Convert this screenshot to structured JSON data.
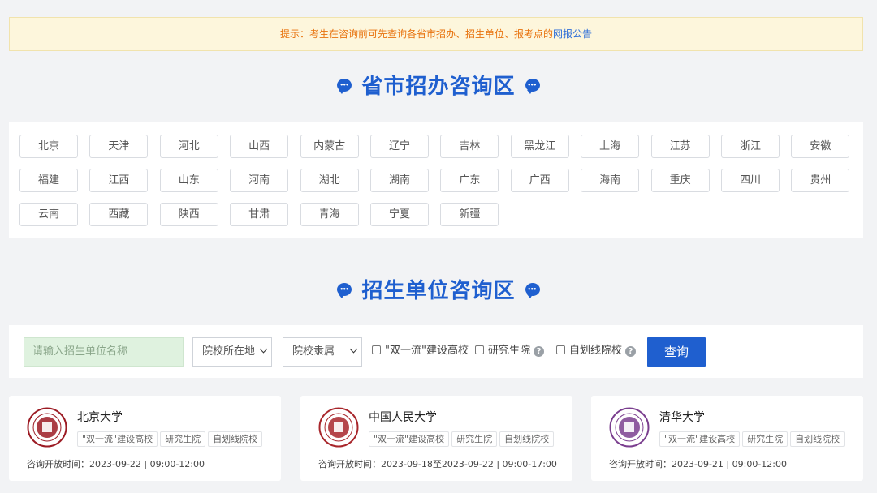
{
  "notice": {
    "prefix": "提示：考生在咨询前可先查询各省市招办、招生单位、报考点的",
    "link": "网报公告"
  },
  "section1": {
    "title": "省市招办咨询区"
  },
  "provinces": [
    "北京",
    "天津",
    "河北",
    "山西",
    "内蒙古",
    "辽宁",
    "吉林",
    "黑龙江",
    "上海",
    "江苏",
    "浙江",
    "安徽",
    "福建",
    "江西",
    "山东",
    "河南",
    "湖北",
    "湖南",
    "广东",
    "广西",
    "海南",
    "重庆",
    "四川",
    "贵州",
    "云南",
    "西藏",
    "陕西",
    "甘肃",
    "青海",
    "宁夏",
    "新疆"
  ],
  "section2": {
    "title": "招生单位咨询区"
  },
  "search": {
    "placeholder": "请输入招生单位名称",
    "location_select": "院校所在地",
    "affiliation_select": "院校隶属",
    "check_double_first": "\"双一流\"建设高校",
    "check_grad_school": "研究生院",
    "check_self_line": "自划线院校",
    "query_button": "查询"
  },
  "universities": [
    {
      "name": "北京大学",
      "tags": [
        "\"双一流\"建设高校",
        "研究生院",
        "自划线院校"
      ],
      "time_label": "咨询开放时间：",
      "time": "2023-09-22 | 09:00-12:00",
      "logo_color": "#9c1b24"
    },
    {
      "name": "中国人民大学",
      "tags": [
        "\"双一流\"建设高校",
        "研究生院",
        "自划线院校"
      ],
      "time_label": "咨询开放时间：",
      "time": "2023-09-18至2023-09-22 | 09:00-17:00",
      "logo_color": "#a8262b"
    },
    {
      "name": "清华大学",
      "tags": [
        "\"双一流\"建设高校",
        "研究生院",
        "自划线院校"
      ],
      "time_label": "咨询开放时间：",
      "time": "2023-09-21 | 09:00-12:00",
      "logo_color": "#7b3f8f"
    }
  ],
  "colors": {
    "accent": "#1f5fcf",
    "notice_text": "#e8730e"
  }
}
